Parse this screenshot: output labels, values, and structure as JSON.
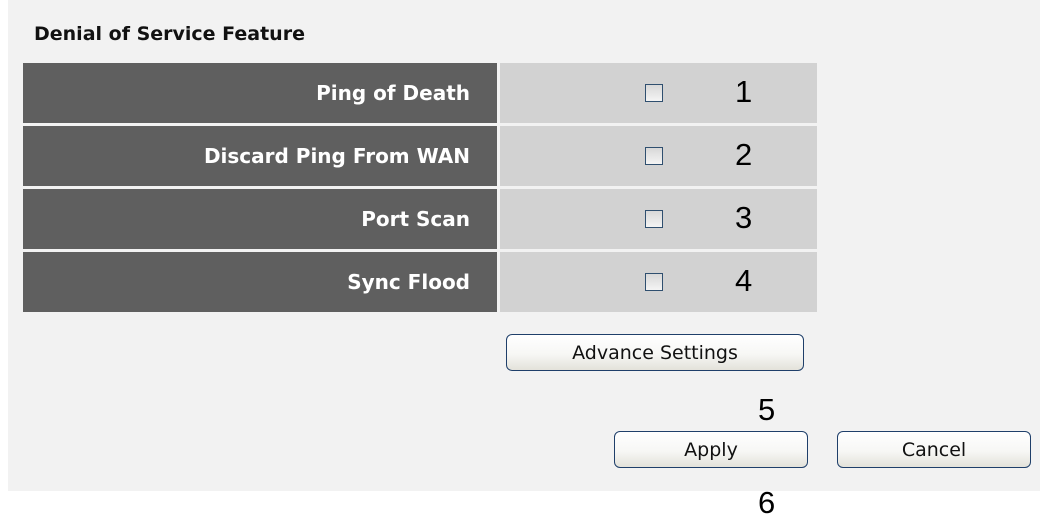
{
  "section": {
    "title": "Denial of Service Feature"
  },
  "dos_options": [
    {
      "label": "Ping of Death",
      "checked": false,
      "marker": "1"
    },
    {
      "label": "Discard Ping From WAN",
      "checked": false,
      "marker": "2"
    },
    {
      "label": "Port Scan",
      "checked": false,
      "marker": "3"
    },
    {
      "label": "Sync Flood",
      "checked": false,
      "marker": "4"
    }
  ],
  "buttons": {
    "advance_settings": "Advance Settings",
    "apply": "Apply",
    "cancel": "Cancel"
  },
  "markers": {
    "advance": "5",
    "apply": "6"
  },
  "colors": {
    "label_cell_bg": "#5f5f5f",
    "control_cell_bg": "#d2d2d2",
    "panel_bg": "#f2f2f2",
    "button_border": "#1f3f6a"
  }
}
